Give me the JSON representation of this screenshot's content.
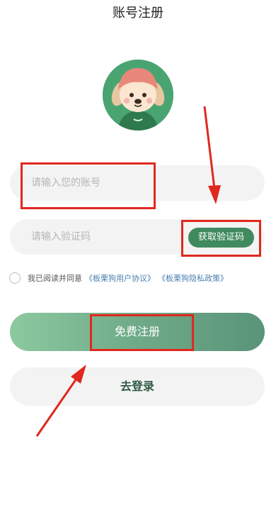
{
  "header": {
    "title": "账号注册"
  },
  "form": {
    "account_placeholder": "请输入您的账号",
    "code_placeholder": "请输入验证码",
    "get_code_label": "获取验证码"
  },
  "agreement": {
    "text": "我已阅读并同意",
    "user_agreement": "《板栗狗用户协议》",
    "privacy_policy": "《板栗狗隐私政策》"
  },
  "actions": {
    "register_label": "免费注册",
    "login_label": "去登录"
  },
  "colors": {
    "accent": "#3f8a5e",
    "annotation_red": "#e0281e",
    "link": "#4a7fb0"
  },
  "icons": {
    "avatar": "dog-mascot-avatar",
    "checkbox": "radio-circle-icon"
  }
}
